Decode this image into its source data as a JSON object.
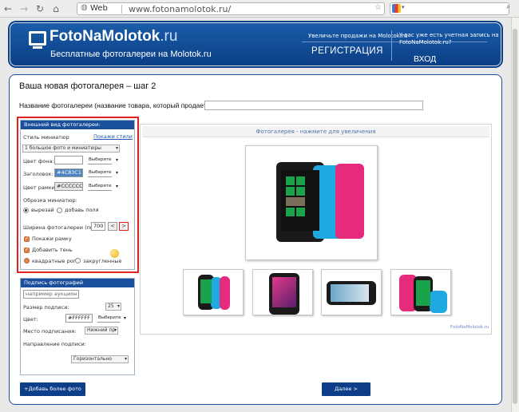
{
  "browser": {
    "back_icon": "back-arrow-icon",
    "web_tag": "Web",
    "url": "www.fotonamolotok.ru/",
    "search_engine_icon": "google-icon"
  },
  "header": {
    "logo_main": "FotoNaMolotok",
    "logo_domain": ".ru",
    "tagline": "Бесплатные фотогалереи на Molotok.ru",
    "promo": "Увеличьте продажи на Molotok.ru",
    "register": "РЕГИСТРАЦИЯ",
    "account_question_line1": "У вас уже есть учетная запись на",
    "account_question_line2": "FotoNaMolotok.ru?",
    "login": "ВХОД"
  },
  "page": {
    "title": "Ваша новая фотогалерея – шаг 2",
    "gallery_name_label": "Название фотогалереи (название товара, который продаете ) :",
    "gallery_name_value": ""
  },
  "appearance": {
    "heading": "Внешний вид фотогалереи:",
    "thumb_style_label": "Стиль миниатюр",
    "show_styles_link": "Покажи стили",
    "thumb_style_value": "1 большое фото и миниатюры",
    "bg_color_label": "Цвет фона:",
    "bg_color_value": "",
    "title_label": "Заголовок:",
    "title_color_value": "#4C83C1",
    "frame_color_label": "Цвет рамки:",
    "frame_color_value": "#CCCCCC",
    "pick_label": "Выберите",
    "crop_label": "Обрезка миниатюр:",
    "crop_option_cut": "вырезай",
    "crop_option_pad": "добавь поля",
    "width_label": "Ширина фотогалереи (пкс):",
    "width_value": "700",
    "show_frame": "Покажи рамку",
    "add_shadow": "Добавить тень",
    "corners_square": "квадратные рога",
    "corners_round": "закругленные",
    "accent_color": "#e1814a"
  },
  "caption": {
    "heading": "Подпись фотографий (необязательный):",
    "placeholder": "например аукцион",
    "size_label": "Размер подписи:",
    "size_value": "25",
    "color_label": "Цвет:",
    "color_value": "#FFFFFF",
    "pick_label": "Выберите",
    "position_label": "Место подписания:",
    "position_value": "Нижний пр",
    "direction_label": "Направление подписи:",
    "direction_value": "Горизонтально"
  },
  "preview": {
    "header": "Фотогалерея - нажмите для увеличения",
    "credit": "FotoNaMolotok.ru"
  },
  "buttons": {
    "add_photo": "+Добавь более фото",
    "next": "Далее >"
  },
  "colors": {
    "header_blue": "#0b3f86",
    "highlight_red": "#e0211d"
  }
}
